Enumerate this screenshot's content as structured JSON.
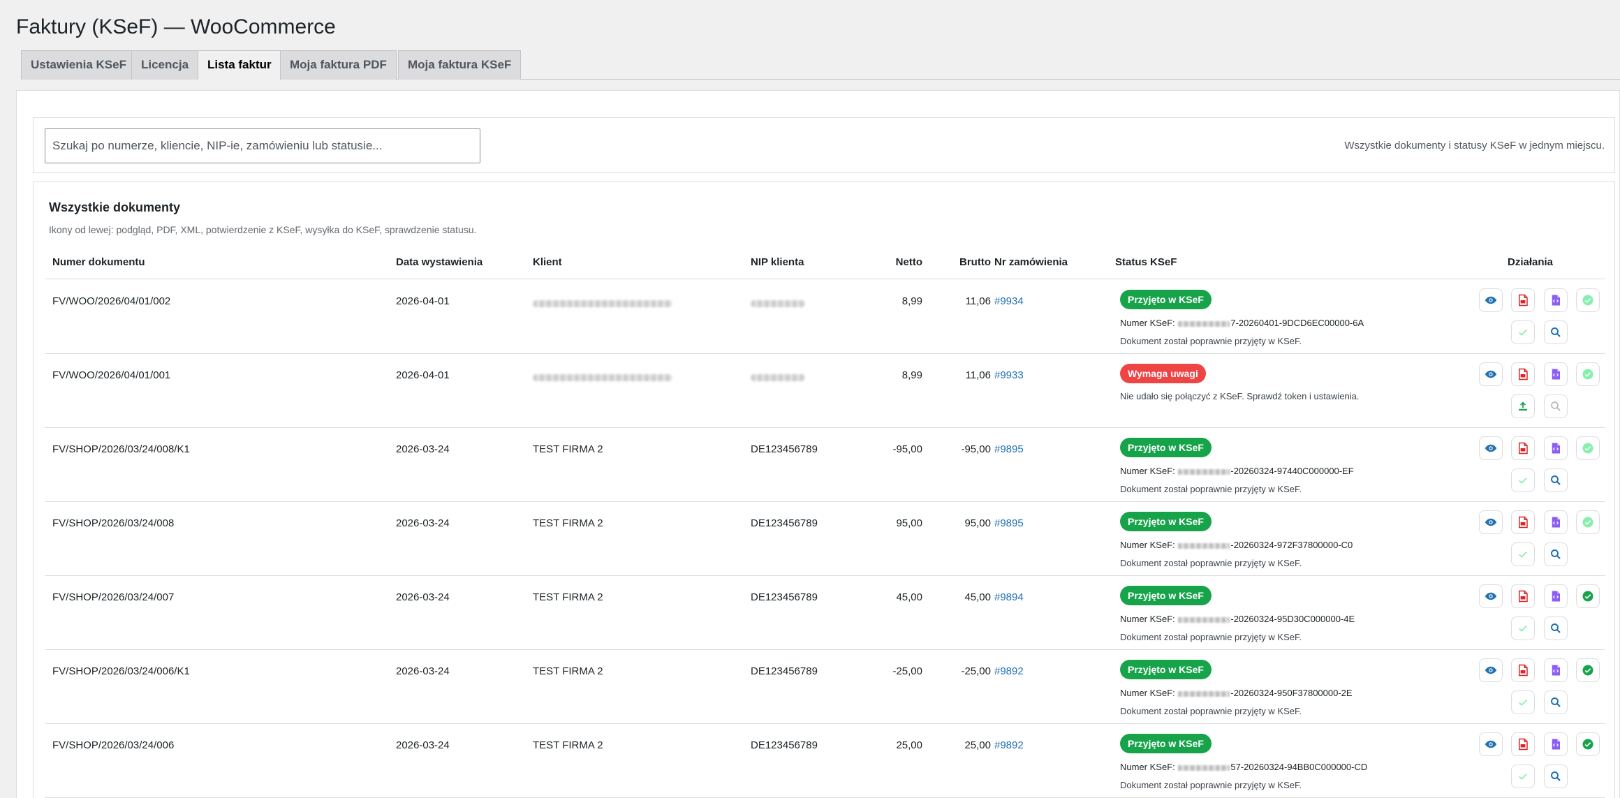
{
  "page": {
    "title": "Faktury (KSeF) — WooCommerce"
  },
  "tabs": [
    {
      "label": "Ustawienia KSeF",
      "active": false
    },
    {
      "label": "Licencja",
      "active": false
    },
    {
      "label": "Lista faktur",
      "active": true
    },
    {
      "label": "Moja faktura PDF",
      "active": false
    },
    {
      "label": "Moja faktura KSeF",
      "active": false
    }
  ],
  "search": {
    "placeholder": "Szukaj po numerze, kliencie, NIP-ie, zamówieniu lub statusie...",
    "value": "",
    "note": "Wszystkie dokumenty i statusy KSeF w jednym miejscu."
  },
  "documents": {
    "title": "Wszystkie dokumenty",
    "subtitle": "Ikony od lewej: podgląd, PDF, XML, potwierdzenie z KSeF, wysyłka do KSeF, sprawdzenie statusu.",
    "columns": {
      "number": "Numer dokumentu",
      "date": "Data wystawienia",
      "client": "Klient",
      "nip": "NIP klienta",
      "net": "Netto",
      "gross": "Brutto",
      "order": "Nr zamówienia",
      "status": "Status KSeF",
      "actions": "Działania"
    },
    "ksef_number_label": "Numer KSeF:",
    "rows": [
      {
        "number": "FV/WOO/2026/04/01/002",
        "date": "2026-04-01",
        "client": "",
        "nip": "",
        "net": "8,99",
        "gross": "11,06",
        "order": "#9934",
        "status": "Przyjęto w KSeF",
        "status_type": "ok",
        "ksef_suffix": "7-20260401-9DCD6EC00000-6A",
        "message": "Dokument został poprawnie przyjęty w KSeF.",
        "confirmation_active": false
      },
      {
        "number": "FV/WOO/2026/04/01/001",
        "date": "2026-04-01",
        "client": "",
        "nip": "",
        "net": "8,99",
        "gross": "11,06",
        "order": "#9933",
        "status": "Wymaga uwagi",
        "status_type": "warn",
        "ksef_suffix": "",
        "message": "Nie udało się połączyć z KSeF. Sprawdź token i ustawienia.",
        "confirmation_active": false
      },
      {
        "number": "FV/SHOP/2026/03/24/008/K1",
        "date": "2026-03-24",
        "client": "TEST FIRMA 2",
        "nip": "DE123456789",
        "net": "-95,00",
        "gross": "-95,00",
        "order": "#9895",
        "status": "Przyjęto w KSeF",
        "status_type": "ok",
        "ksef_suffix": "-20260324-97440C000000-EF",
        "message": "Dokument został poprawnie przyjęty w KSeF.",
        "confirmation_active": false
      },
      {
        "number": "FV/SHOP/2026/03/24/008",
        "date": "2026-03-24",
        "client": "TEST FIRMA 2",
        "nip": "DE123456789",
        "net": "95,00",
        "gross": "95,00",
        "order": "#9895",
        "status": "Przyjęto w KSeF",
        "status_type": "ok",
        "ksef_suffix": "-20260324-972F37800000-C0",
        "message": "Dokument został poprawnie przyjęty w KSeF.",
        "confirmation_active": false
      },
      {
        "number": "FV/SHOP/2026/03/24/007",
        "date": "2026-03-24",
        "client": "TEST FIRMA 2",
        "nip": "DE123456789",
        "net": "45,00",
        "gross": "45,00",
        "order": "#9894",
        "status": "Przyjęto w KSeF",
        "status_type": "ok",
        "ksef_suffix": "-20260324-95D30C000000-4E",
        "message": "Dokument został poprawnie przyjęty w KSeF.",
        "confirmation_active": true
      },
      {
        "number": "FV/SHOP/2026/03/24/006/K1",
        "date": "2026-03-24",
        "client": "TEST FIRMA 2",
        "nip": "DE123456789",
        "net": "-25,00",
        "gross": "-25,00",
        "order": "#9892",
        "status": "Przyjęto w KSeF",
        "status_type": "ok",
        "ksef_suffix": "-20260324-950F37800000-2E",
        "message": "Dokument został poprawnie przyjęty w KSeF.",
        "confirmation_active": true
      },
      {
        "number": "FV/SHOP/2026/03/24/006",
        "date": "2026-03-24",
        "client": "TEST FIRMA 2",
        "nip": "DE123456789",
        "net": "25,00",
        "gross": "25,00",
        "order": "#9892",
        "status": "Przyjęto w KSeF",
        "status_type": "ok",
        "ksef_suffix": "57-20260324-94BB0C000000-CD",
        "message": "Dokument został poprawnie przyjęty w KSeF.",
        "confirmation_active": true
      }
    ]
  },
  "action_icons": [
    "view-icon",
    "pdf-icon",
    "xml-icon",
    "ksef-confirmation-icon",
    "send-to-ksef-icon",
    "check-status-icon"
  ],
  "colors": {
    "ok": "#16a34a",
    "warn": "#ef4444",
    "link": "#2271b1",
    "pdf": "#dc2626",
    "xml": "#8b5cf6",
    "view": "#2271b1",
    "confirm_active": "#16a34a",
    "confirm_muted": "#86efac"
  }
}
